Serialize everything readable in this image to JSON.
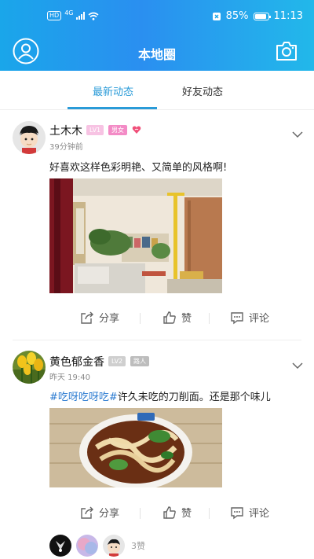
{
  "status_bar": {
    "network": "4G",
    "battery": "85%",
    "time": "11:13",
    "hd": "HD"
  },
  "header": {
    "title": "本地圈",
    "left_icon": "user-icon",
    "right_icon": "camera-icon"
  },
  "tabs": [
    {
      "label": "最新动态",
      "active": true
    },
    {
      "label": "好友动态",
      "active": false
    }
  ],
  "posts": [
    {
      "username": "土木木",
      "level": "LV1",
      "tag": "男女",
      "time": "39分钟前",
      "text": "好喜欢这样色彩明艳、又简单的风格啊!",
      "image": "living room interior photo"
    },
    {
      "username": "黄色郁金香",
      "level": "LV2",
      "tag": "路人",
      "time": "昨天 19:40",
      "hashtag": "#吃呀吃呀吃#",
      "text": "许久未吃的刀削面。还是那个味儿",
      "image": "noodle bowl photo"
    }
  ],
  "actions": {
    "share": "分享",
    "like": "赞",
    "comment": "评论"
  },
  "likes": {
    "count": "3赞"
  },
  "colors": {
    "accent": "#2a9bd8",
    "header_start": "#1aa6ea",
    "header_end": "#22b8ea"
  }
}
